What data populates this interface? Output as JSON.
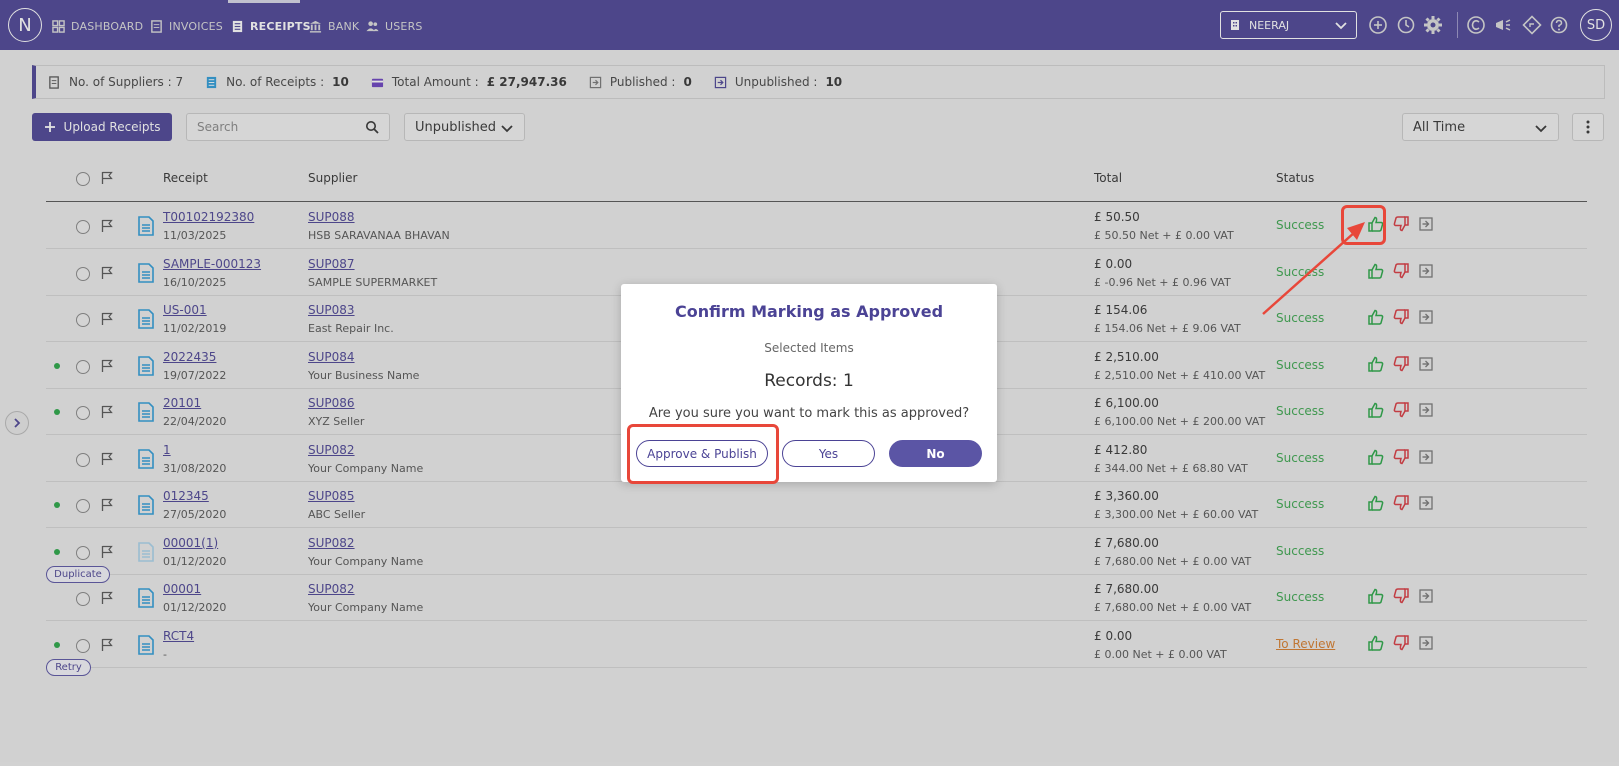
{
  "nav": {
    "logo": "N",
    "items": [
      {
        "label": "DASHBOARD",
        "icon": "dashboard-icon"
      },
      {
        "label": "INVOICES",
        "icon": "invoice-icon"
      },
      {
        "label": "RECEIPTS",
        "icon": "receipt-icon",
        "active": true
      },
      {
        "label": "BANK",
        "icon": "bank-icon"
      },
      {
        "label": "USERS",
        "icon": "users-icon"
      }
    ],
    "company": "NEERAJ",
    "avatar": "SD"
  },
  "summary": {
    "suppliers": "No. of Suppliers : 7",
    "receipts_label": "No. of Receipts :",
    "receipts_value": "10",
    "total_label": "Total Amount :",
    "total_value": "£ 27,947.36",
    "published_label": "Published :",
    "published_value": "0",
    "unpublished_label": "Unpublished :",
    "unpublished_value": "10"
  },
  "toolbar": {
    "upload_label": "Upload Receipts",
    "search_placeholder": "Search",
    "filter_value": "Unpublished",
    "time_value": "All Time"
  },
  "table": {
    "headers": {
      "receipt": "Receipt",
      "supplier": "Supplier",
      "total": "Total",
      "status": "Status"
    },
    "rows": [
      {
        "receipt": "T00102192380",
        "date": "11/03/2025",
        "supplier": "SUP088",
        "supplier_name": "HSB SARAVANAA BHAVAN",
        "total": "£ 50.50",
        "breakdown": "£ 50.50 Net  +  £ 0.00 VAT",
        "status": "Success"
      },
      {
        "receipt": "SAMPLE-000123",
        "date": "16/10/2025",
        "supplier": "SUP087",
        "supplier_name": "SAMPLE SUPERMARKET",
        "total": "£ 0.00",
        "breakdown": "£ -0.96 Net  +  £ 0.96 VAT",
        "status": "Success"
      },
      {
        "receipt": "US-001",
        "date": "11/02/2019",
        "supplier": "SUP083",
        "supplier_name": "East Repair Inc.",
        "total": "£ 154.06",
        "breakdown": "£ 154.06 Net  +  £ 9.06 VAT",
        "status": "Success"
      },
      {
        "receipt": "2022435",
        "date": "19/07/2022",
        "supplier": "SUP084",
        "supplier_name": "Your Business Name",
        "total": "£ 2,510.00",
        "breakdown": "£ 2,510.00 Net  +  £ 410.00 VAT",
        "status": "Success"
      },
      {
        "receipt": "20101",
        "date": "22/04/2020",
        "supplier": "SUP086",
        "supplier_name": "XYZ Seller",
        "total": "£ 6,100.00",
        "breakdown": "£ 6,100.00 Net  +  £ 200.00 VAT",
        "status": "Success"
      },
      {
        "receipt": "1",
        "date": "31/08/2020",
        "supplier": "SUP082",
        "supplier_name": "Your Company Name",
        "total": "£ 412.80",
        "breakdown": "£ 344.00 Net  +  £ 68.80 VAT",
        "status": "Success"
      },
      {
        "receipt": "012345",
        "date": "27/05/2020",
        "supplier": "SUP085",
        "supplier_name": "ABC Seller",
        "total": "£ 3,360.00",
        "breakdown": "£ 3,300.00 Net  +  £ 60.00 VAT",
        "status": "Success"
      },
      {
        "receipt": "00001(1)",
        "date": "01/12/2020",
        "supplier": "SUP082",
        "supplier_name": "Your Company Name",
        "total": "£ 7,680.00",
        "breakdown": "£ 7,680.00 Net  +  £ 0.00 VAT",
        "status": "Success",
        "badge": "Duplicate"
      },
      {
        "receipt": "00001",
        "date": "01/12/2020",
        "supplier": "SUP082",
        "supplier_name": "Your Company Name",
        "total": "£ 7,680.00",
        "breakdown": "£ 7,680.00 Net  +  £ 0.00 VAT",
        "status": "Success"
      },
      {
        "receipt": "RCT4",
        "date": "-",
        "supplier": "",
        "supplier_name": "",
        "total": "£ 0.00",
        "breakdown": "£ 0.00 Net  +  £ 0.00 VAT",
        "status": "To Review",
        "badge": "Retry"
      }
    ]
  },
  "modal": {
    "title": "Confirm Marking as Approved",
    "selected_label": "Selected Items",
    "records": "Records: 1",
    "question": "Are you sure you want to mark this as approved?",
    "approve_publish": "Approve & Publish",
    "yes": "Yes",
    "no": "No"
  },
  "colors": {
    "brand": "#4b4395",
    "success": "#3aa64d",
    "review": "#d77d2b",
    "approve": "#27a745",
    "reject": "#d9363e",
    "highlight": "#e8473a"
  }
}
